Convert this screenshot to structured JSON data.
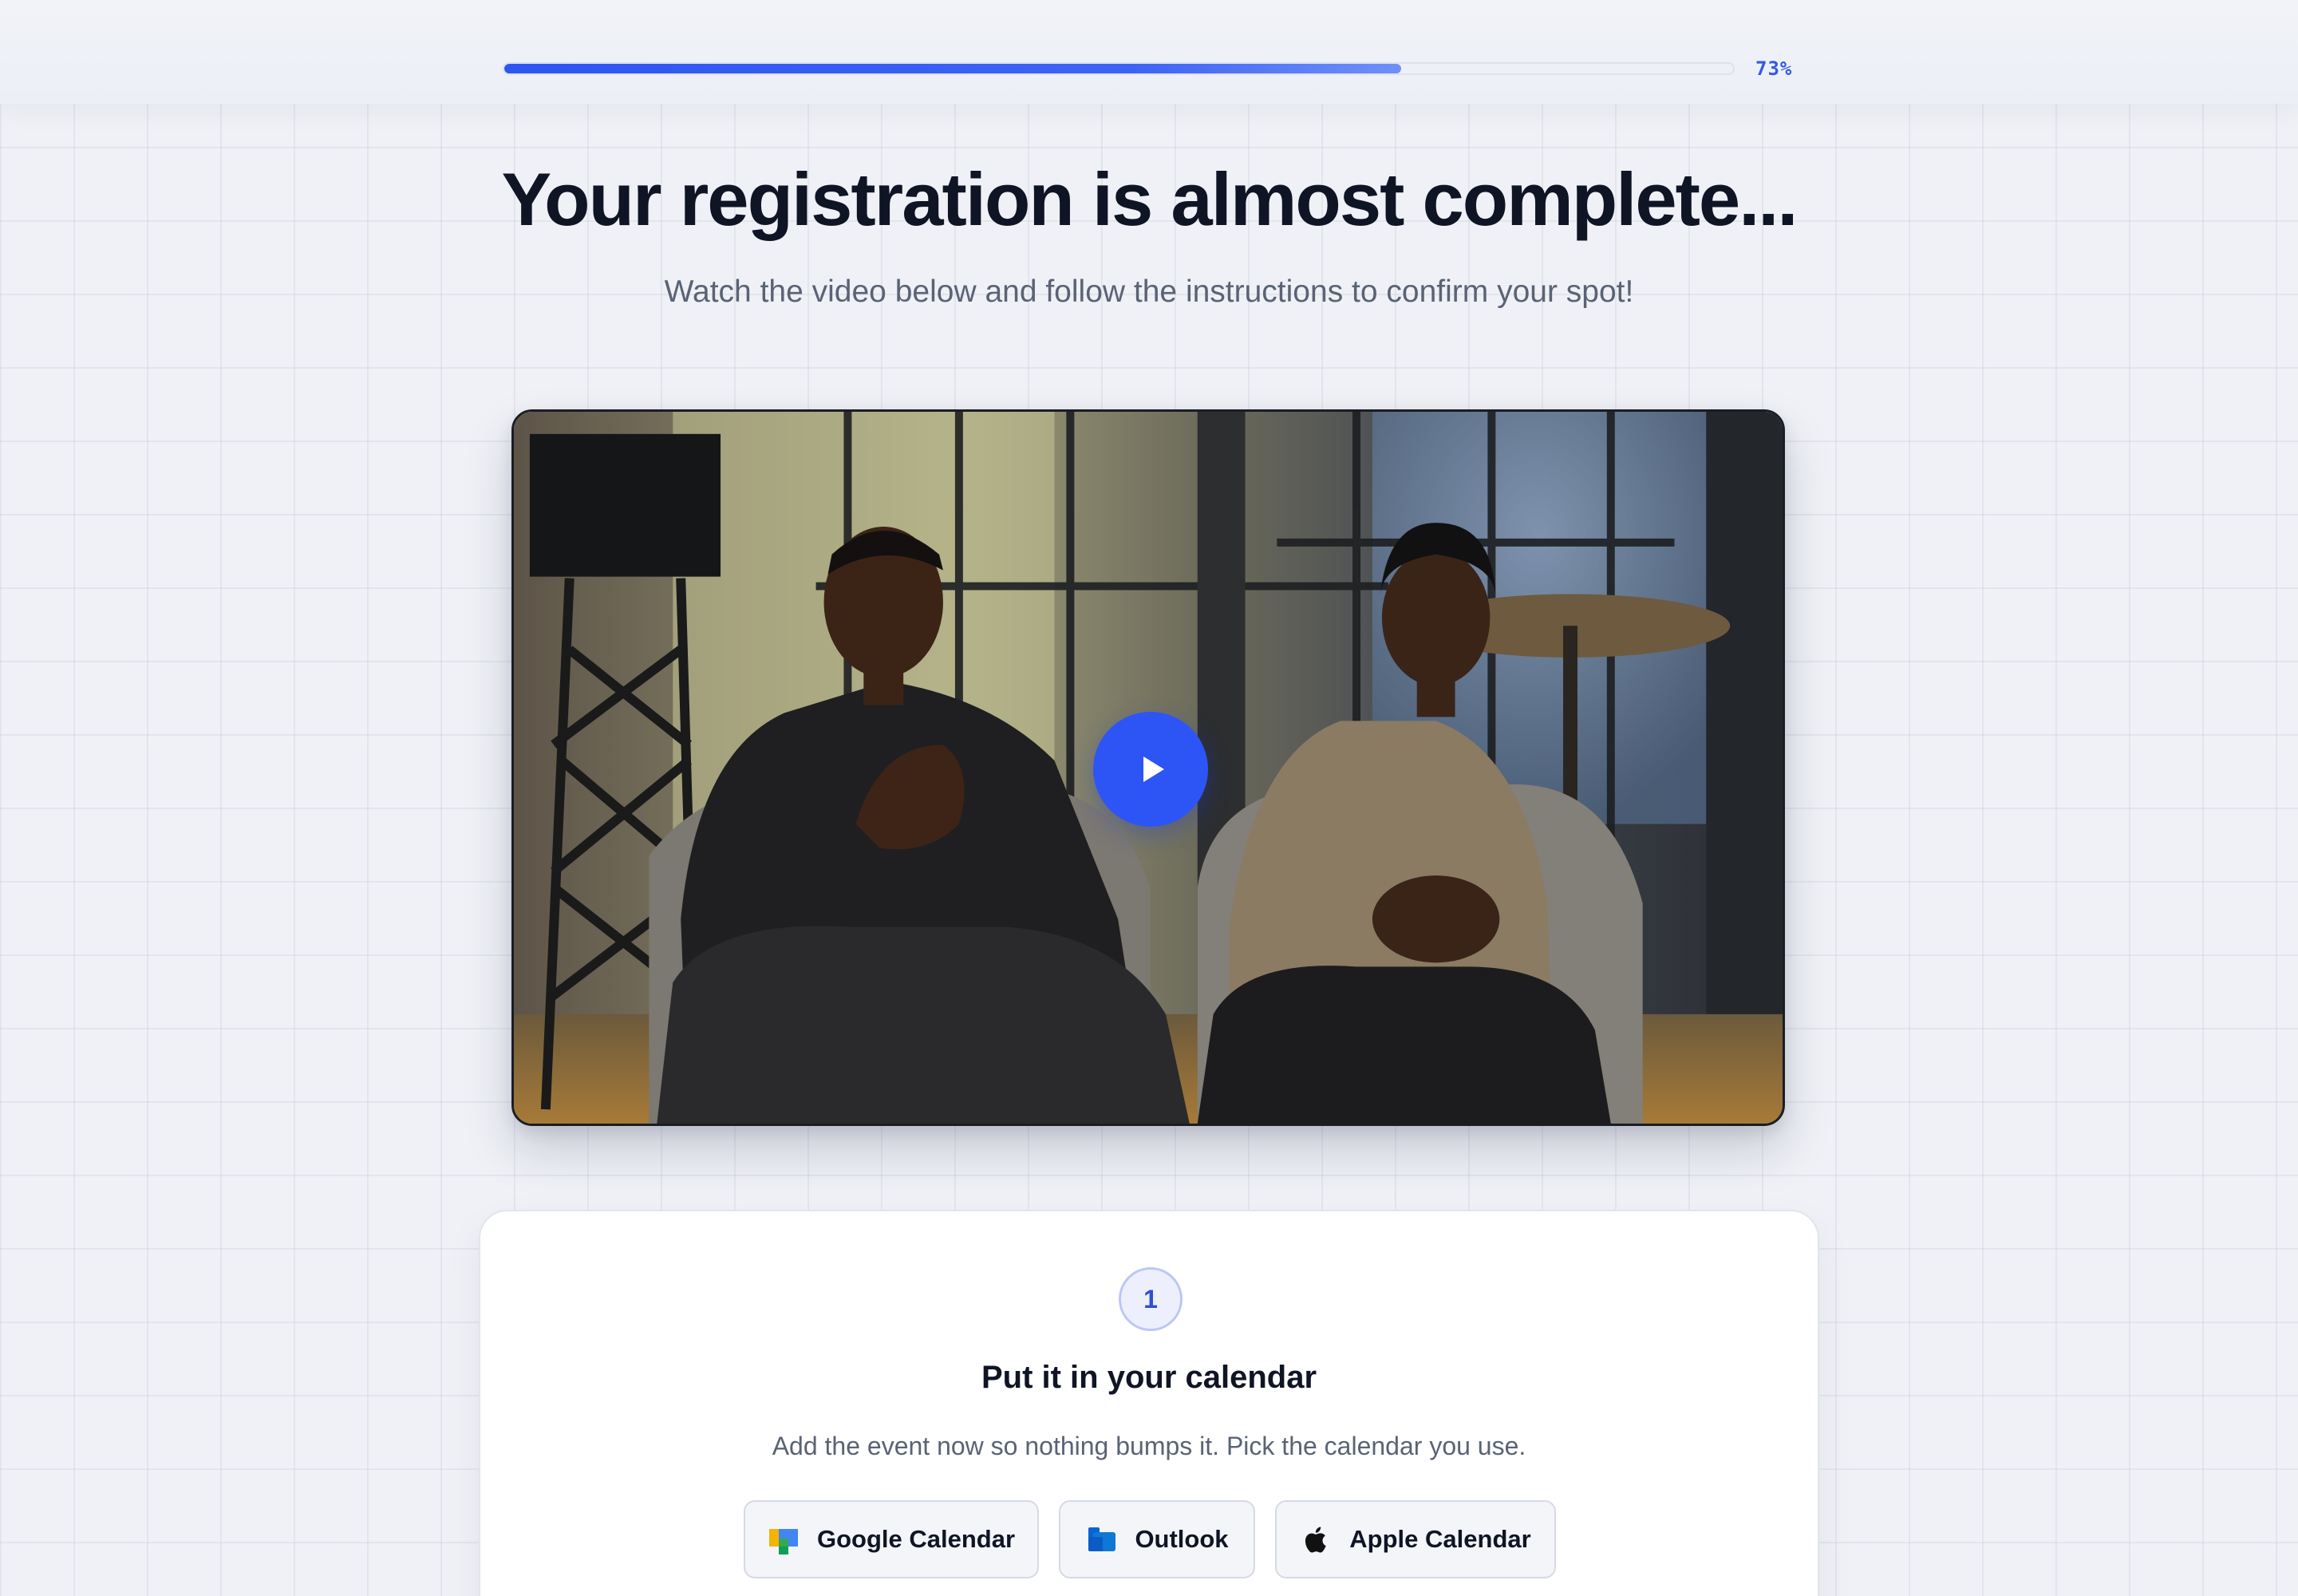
{
  "progress": {
    "value": 0.73,
    "label": "73%"
  },
  "hero": {
    "title": "Your registration is almost complete...",
    "subtitle": "Watch the video below and follow the instructions to confirm your spot!"
  },
  "video": {
    "play_icon": "play-icon"
  },
  "step": {
    "number": "1",
    "title": "Put it in your calendar",
    "description": "Add the event now so nothing bumps it. Pick the calendar you use.",
    "buttons": [
      {
        "label": "Google Calendar",
        "icon": "google-calendar-icon"
      },
      {
        "label": "Outlook",
        "icon": "outlook-icon"
      },
      {
        "label": "Apple Calendar",
        "icon": "apple-icon"
      }
    ]
  },
  "colors": {
    "accent": "#2d55f5",
    "heading": "#0f1525",
    "muted": "#5a6375",
    "background": "#eff1f6"
  }
}
